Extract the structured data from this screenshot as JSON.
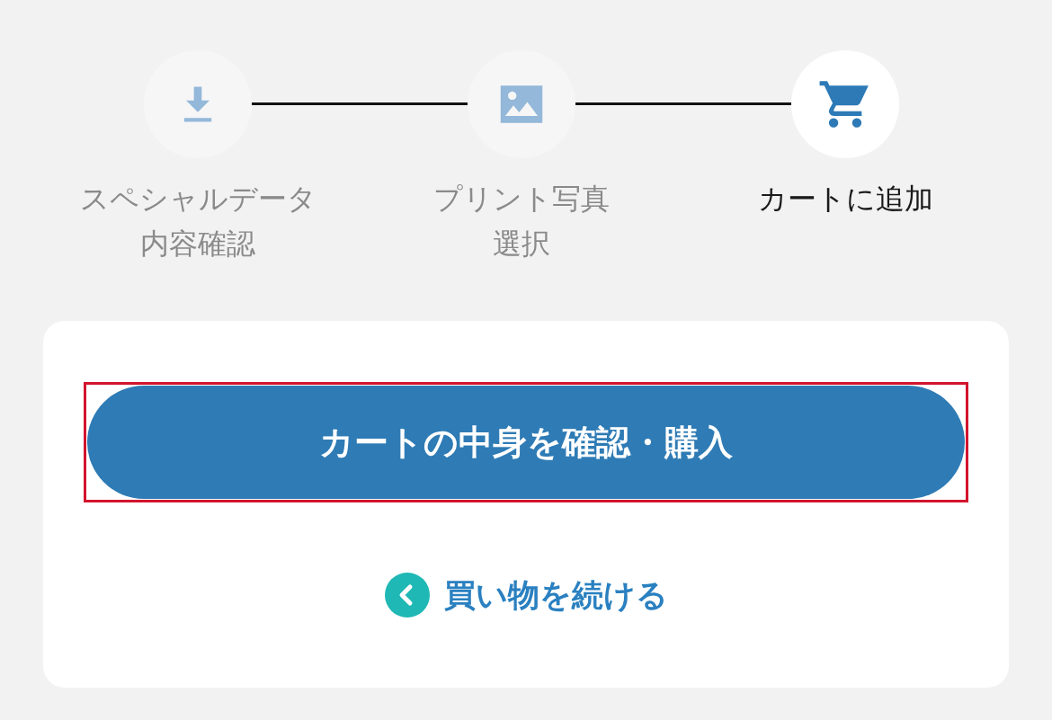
{
  "steps": [
    {
      "kind": "download",
      "lines": [
        "スペシャルデータ",
        "内容確認"
      ],
      "selected": false
    },
    {
      "kind": "image",
      "lines": [
        "プリント写真",
        "選択"
      ],
      "selected": false
    },
    {
      "kind": "cart",
      "lines": [
        "カートに追加"
      ],
      "selected": true
    }
  ],
  "card": {
    "primary_button": {
      "label": "カートの中身を確認・購入",
      "highlighted": true
    },
    "link": {
      "label": "買い物を続ける"
    }
  }
}
